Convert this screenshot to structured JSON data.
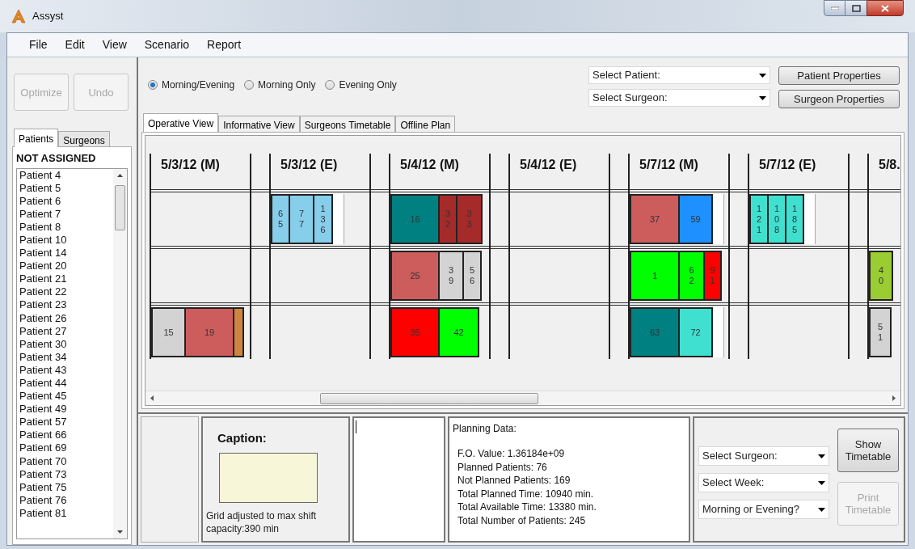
{
  "window": {
    "title": "Assyst"
  },
  "menu": [
    "File",
    "Edit",
    "View",
    "Scenario",
    "Report"
  ],
  "left_panel": {
    "buttons": [
      {
        "label": "Optimize",
        "disabled": true
      },
      {
        "label": "Undo",
        "disabled": true
      }
    ],
    "tabs": [
      {
        "label": "Patients",
        "selected": true
      },
      {
        "label": "Surgeons",
        "selected": false
      }
    ],
    "list_title": "NOT ASSIGNED",
    "patients": [
      "Patient 4",
      "Patient 5",
      "Patient 6",
      "Patient 7",
      "Patient 8",
      "Patient 10",
      "Patient 14",
      "Patient 20",
      "Patient 21",
      "Patient 22",
      "Patient 23",
      "Patient 26",
      "Patient 27",
      "Patient 30",
      "Patient 34",
      "Patient 43",
      "Patient 44",
      "Patient 45",
      "Patient 49",
      "Patient 57",
      "Patient 66",
      "Patient 69",
      "Patient 70",
      "Patient 73",
      "Patient 75",
      "Patient 76",
      "Patient 81"
    ]
  },
  "shift_options": [
    {
      "label": "Morning/Evening",
      "selected": true
    },
    {
      "label": "Morning Only",
      "selected": false
    },
    {
      "label": "Evening Only",
      "selected": false
    }
  ],
  "selects": [
    {
      "value": "Select Patient:"
    },
    {
      "value": "Select Surgeon:"
    }
  ],
  "property_buttons": [
    "Patient Properties",
    "Surgeon Properties"
  ],
  "view_tabs": [
    {
      "label": "Operative View",
      "selected": true
    },
    {
      "label": "Informative View",
      "selected": false
    },
    {
      "label": "Surgeons Timetable",
      "selected": false
    },
    {
      "label": "Offline Plan",
      "selected": false
    }
  ],
  "grid": {
    "columns": [
      {
        "date": "5/3/12 (M)",
        "rows": [
          {},
          {},
          {
            "blocks": [
              {
                "label": "15",
                "color": "#d3d3d3"
              },
              {
                "label": "19",
                "color": "#cd5c5c"
              },
              {
                "color": "#cd853f"
              }
            ]
          }
        ]
      },
      {
        "date": "5/3/12 (E)",
        "rows": [
          {
            "overtime": true,
            "blocks": [
              {
                "label": "65",
                "color": "#87ceeb"
              },
              {
                "label": "77",
                "color": "#87ceeb"
              },
              {
                "label": "136",
                "color": "#87ceeb"
              }
            ]
          },
          {},
          {}
        ]
      },
      {
        "date": "5/4/12 (M)",
        "rows": [
          {
            "blocks": [
              {
                "label": "16",
                "color": "#008080"
              },
              {
                "label": "32",
                "color": "#a52a2a"
              },
              {
                "label": "33",
                "color": "#a52a2a"
              }
            ]
          },
          {
            "blocks": [
              {
                "label": "25",
                "color": "#cd5c5c"
              },
              {
                "label": "39",
                "color": "#d3d3d3"
              },
              {
                "label": "56",
                "color": "#d3d3d3"
              }
            ]
          },
          {
            "blocks": [
              {
                "label": "35",
                "color": "#ff0000"
              },
              {
                "label": "42",
                "color": "#00ff00"
              }
            ]
          }
        ]
      },
      {
        "date": "5/4/12 (E)",
        "rows": [
          {},
          {},
          {}
        ]
      },
      {
        "date": "5/7/12 (M)",
        "rows": [
          {
            "overtime": true,
            "blocks": [
              {
                "label": "37",
                "color": "#cd5c5c"
              },
              {
                "label": "59",
                "color": "#1e90ff"
              }
            ]
          },
          {
            "blocks": [
              {
                "label": "1",
                "color": "#00ff00"
              },
              {
                "label": "62",
                "color": "#00ff00"
              },
              {
                "label": "91",
                "color": "#ff0000"
              }
            ]
          },
          {
            "overtime": true,
            "blocks": [
              {
                "label": "63",
                "color": "#008080"
              },
              {
                "label": "72",
                "color": "#40e0d0"
              }
            ]
          }
        ]
      },
      {
        "date": "5/7/12 (E)",
        "rows": [
          {
            "overtime": true,
            "blocks": [
              {
                "label": "121",
                "color": "#40e0d0"
              },
              {
                "label": "108",
                "color": "#40e0d0"
              },
              {
                "label": "185",
                "color": "#40e0d0"
              }
            ]
          },
          {},
          {}
        ]
      },
      {
        "date": "5/8.",
        "rows": [
          {},
          {
            "blocks": [
              {
                "label": "40",
                "color": "#9acd32"
              }
            ]
          },
          {
            "blocks": [
              {
                "label": "51",
                "color": "#d3d3d3"
              }
            ]
          }
        ]
      }
    ]
  },
  "caption": {
    "title": "Caption:",
    "note": "Grid adjusted to max shift capacity:390 min"
  },
  "planning_data": {
    "title": "Planning Data:",
    "lines": [
      "F.O. Value: 1.36184e+09",
      "Planned Patients: 76",
      "Not Planned Patients: 169",
      "Total Planned Time: 10940 min.",
      "Total Available Time: 13380 min.",
      "Total Number of Patients: 245"
    ]
  },
  "timetable": {
    "selects": [
      {
        "value": "Select Surgeon:"
      },
      {
        "value": "Select Week:"
      },
      {
        "value": "Morning or Evening?"
      }
    ],
    "buttons": [
      {
        "label": "Show Timetable",
        "disabled": false
      },
      {
        "label": "Print Timetable",
        "disabled": true
      }
    ]
  }
}
